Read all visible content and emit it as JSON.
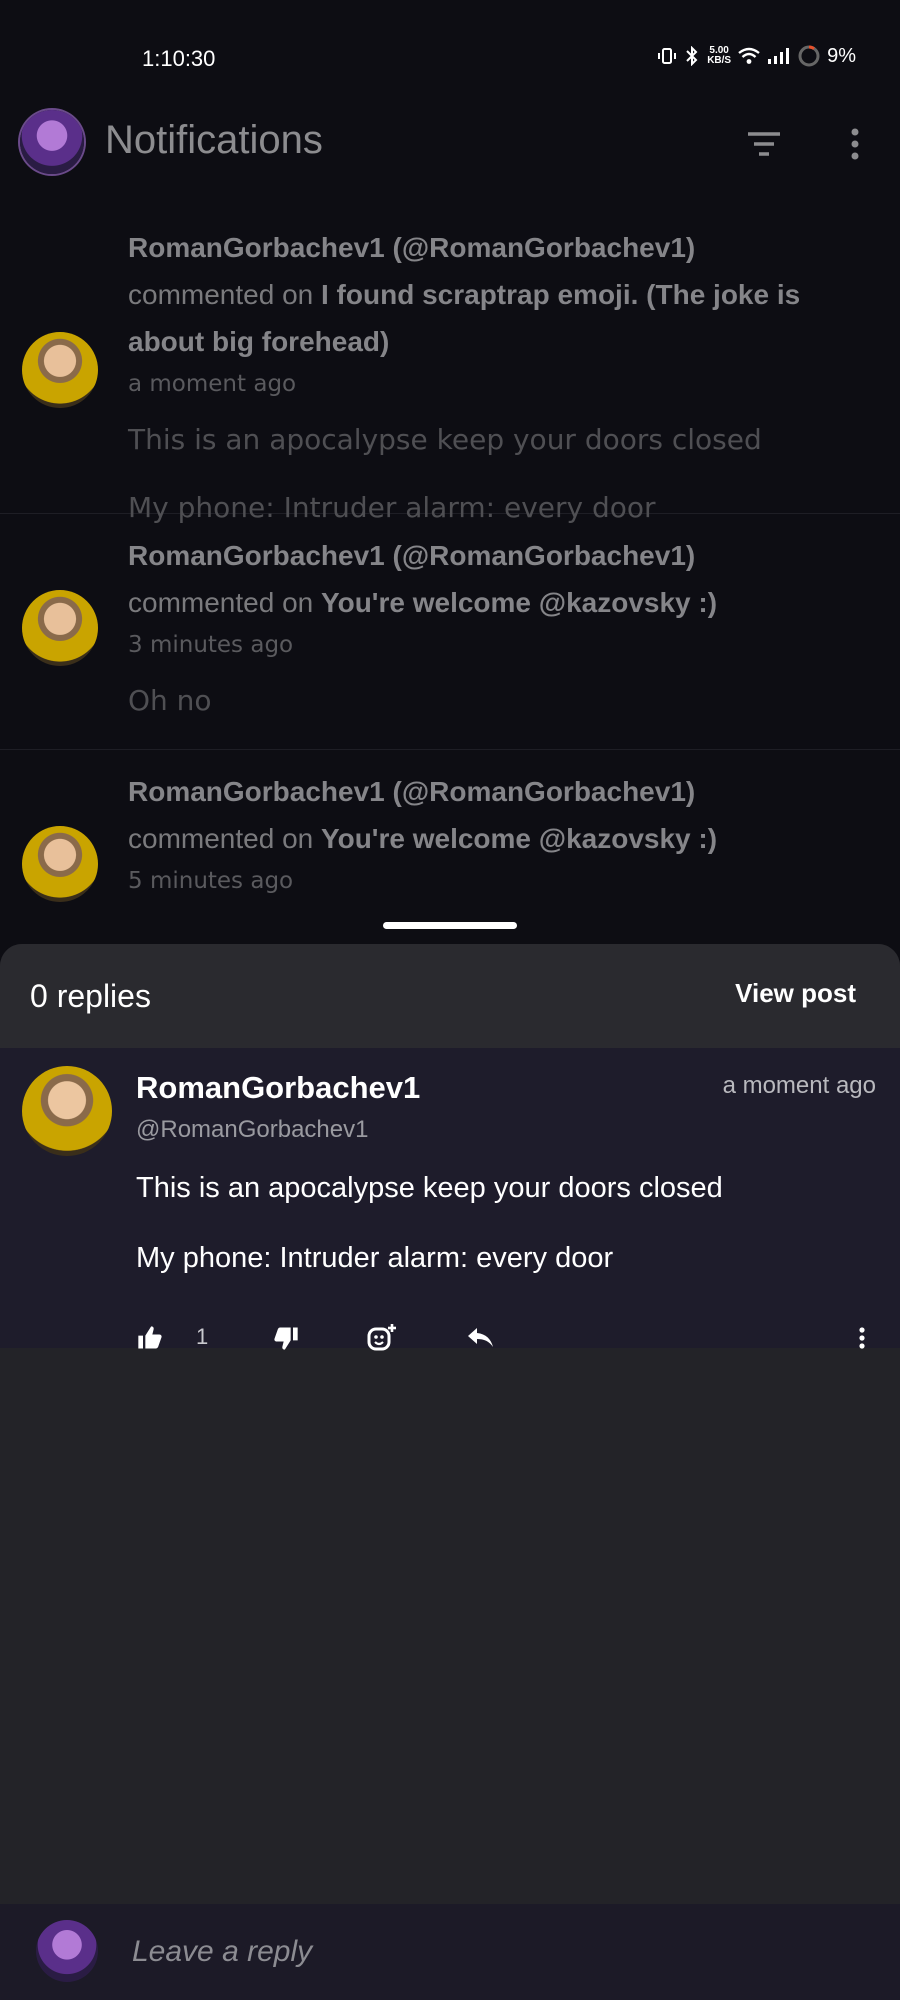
{
  "status_bar": {
    "time": "1:10:30",
    "net_speed": "5.00",
    "net_unit": "KB/S",
    "battery": "9%"
  },
  "header": {
    "title": "Notifications",
    "avatar_icon": "bonnie-avatar",
    "filter_icon": "filter-icon",
    "more_icon": "more-vertical-icon"
  },
  "notifications": [
    {
      "author": "RomanGorbachev1 (@RomanGorbachev1)",
      "action": "commented on",
      "post_title": "I found scraptrap emoji. (The joke is about big forehead)",
      "time": "a moment ago",
      "body": "This is an apocalypse keep your doors closed",
      "body2": "My phone: Intruder alarm: every door"
    },
    {
      "author": "RomanGorbachev1 (@RomanGorbachev1)",
      "action": "commented on",
      "post_title": "You're welcome @kazovsky :)",
      "time": "3 minutes ago",
      "body": "Oh no"
    },
    {
      "author": "RomanGorbachev1 (@RomanGorbachev1)",
      "action": "commented on",
      "post_title": "You're welcome @kazovsky :)",
      "time": "5 minutes ago"
    }
  ],
  "sheet": {
    "replies_count": "0 replies",
    "view_post": "View post",
    "comment": {
      "name": "RomanGorbachev1",
      "handle": "@RomanGorbachev1",
      "time": "a moment ago",
      "line1": "This is an apocalypse keep your doors closed",
      "line2": "My phone: Intruder alarm: every door",
      "likes": "1"
    }
  },
  "reply_bar": {
    "placeholder": "Leave a reply"
  }
}
